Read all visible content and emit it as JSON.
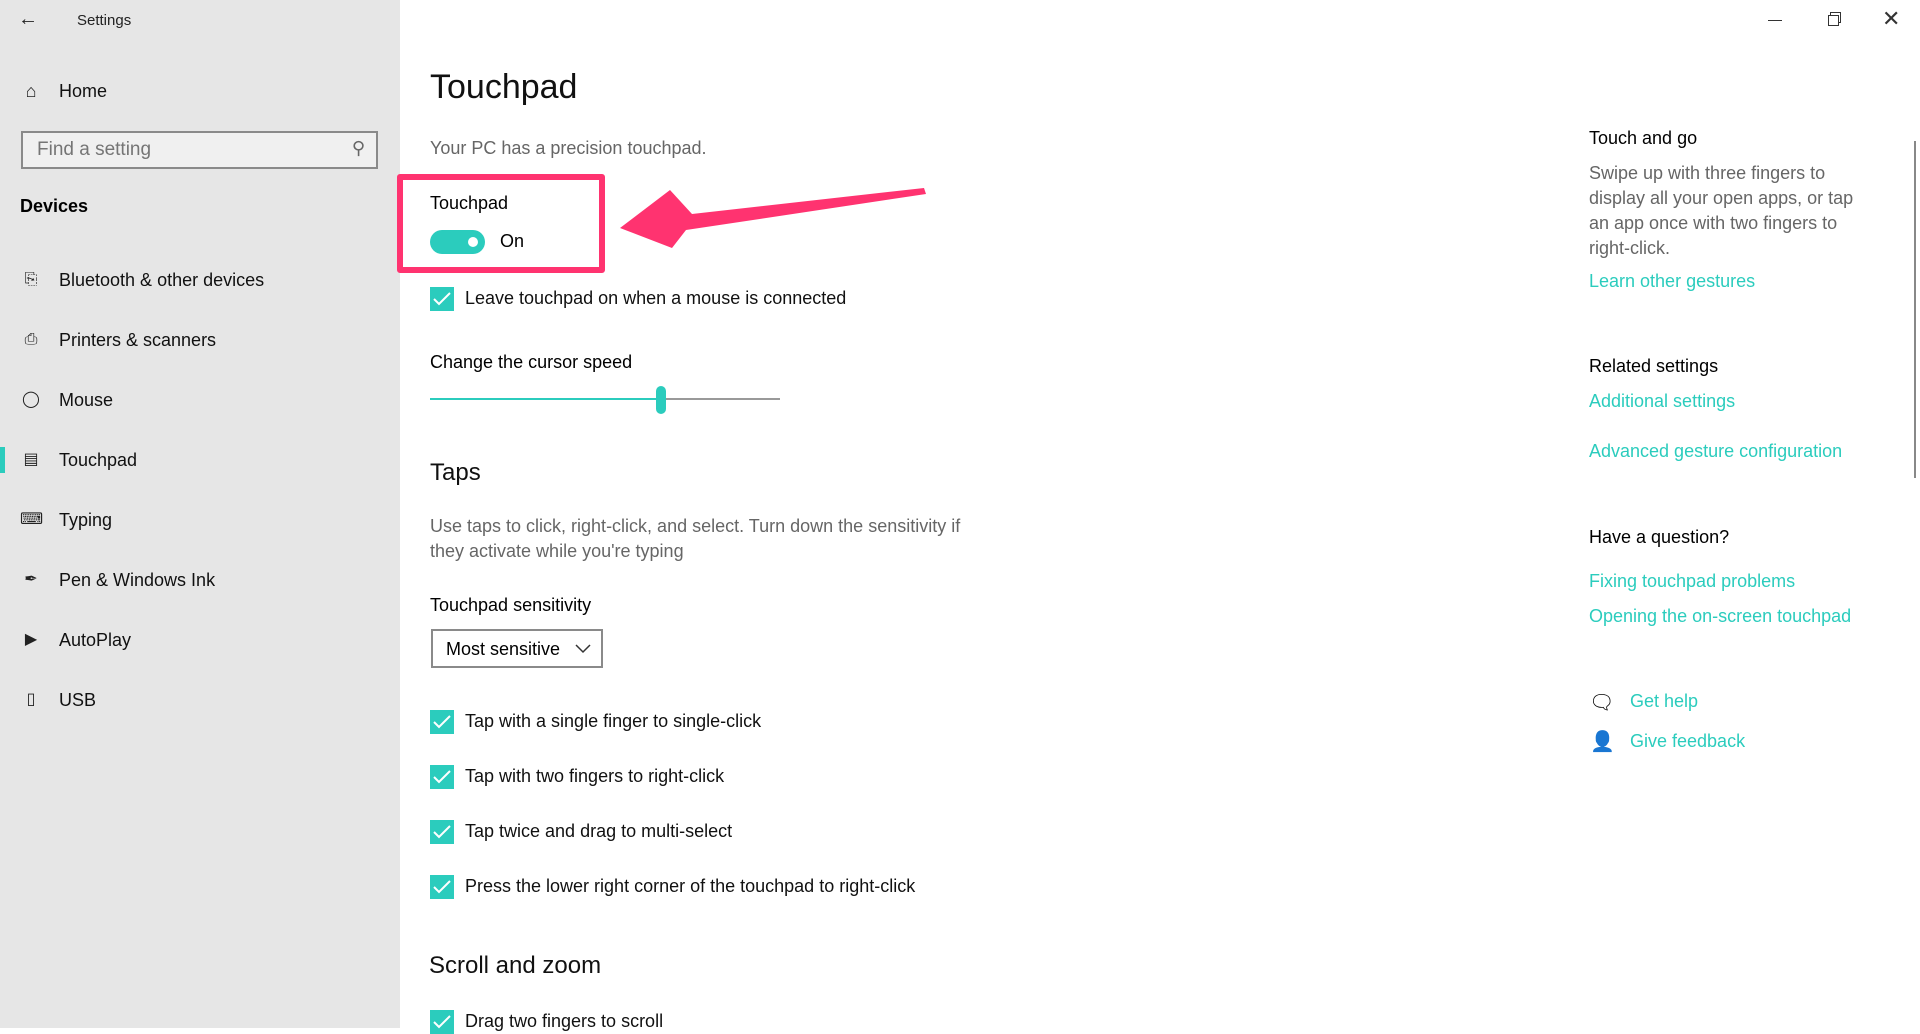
{
  "window": {
    "title": "Settings",
    "minimize": "minimize-icon",
    "restore": "restore-icon",
    "close": "close-icon"
  },
  "sidebar": {
    "home": "Home",
    "search_placeholder": "Find a setting",
    "section": "Devices",
    "items": [
      {
        "label": "Bluetooth & other devices",
        "icon": "bluetooth-devices-icon"
      },
      {
        "label": "Printers & scanners",
        "icon": "printer-icon"
      },
      {
        "label": "Mouse",
        "icon": "mouse-icon"
      },
      {
        "label": "Touchpad",
        "icon": "touchpad-icon",
        "selected": true
      },
      {
        "label": "Typing",
        "icon": "keyboard-icon"
      },
      {
        "label": "Pen & Windows Ink",
        "icon": "pen-icon"
      },
      {
        "label": "AutoPlay",
        "icon": "autoplay-icon"
      },
      {
        "label": "USB",
        "icon": "usb-icon"
      }
    ]
  },
  "main": {
    "title": "Touchpad",
    "subtitle": "Your PC has a precision touchpad.",
    "touchpad_label": "Touchpad",
    "toggle_state": "On",
    "leave_on": "Leave touchpad on when a mouse is connected",
    "cursor_speed_label": "Change the cursor speed",
    "cursor_speed_fraction": 0.66,
    "taps_heading": "Taps",
    "taps_desc_1": "Use taps to click, right-click, and select. Turn down the sensitivity if",
    "taps_desc_2": "they activate while you're typing",
    "sensitivity_label": "Touchpad sensitivity",
    "sensitivity_value": "Most sensitive",
    "tap_options": [
      "Tap with a single finger to single-click",
      "Tap with two fingers to right-click",
      "Tap twice and drag to multi-select",
      "Press the lower right corner of the touchpad to right-click"
    ],
    "scroll_heading": "Scroll and zoom",
    "scroll_option": "Drag two fingers to scroll"
  },
  "right": {
    "touch_heading": "Touch and go",
    "touch_desc": [
      "Swipe up with three fingers to",
      "display all your open apps, or tap",
      "an app once with two fingers to",
      "right-click."
    ],
    "learn": "Learn other gestures",
    "related_heading": "Related settings",
    "additional": "Additional settings",
    "advanced": "Advanced gesture configuration",
    "question_heading": "Have a question?",
    "fixing": "Fixing touchpad problems",
    "opening": "Opening the on-screen touchpad",
    "get_help": "Get help",
    "feedback": "Give feedback"
  },
  "colors": {
    "accent": "#2bccbd",
    "annotation": "#ff3370",
    "sidebar_bg": "#e6e6e6"
  }
}
